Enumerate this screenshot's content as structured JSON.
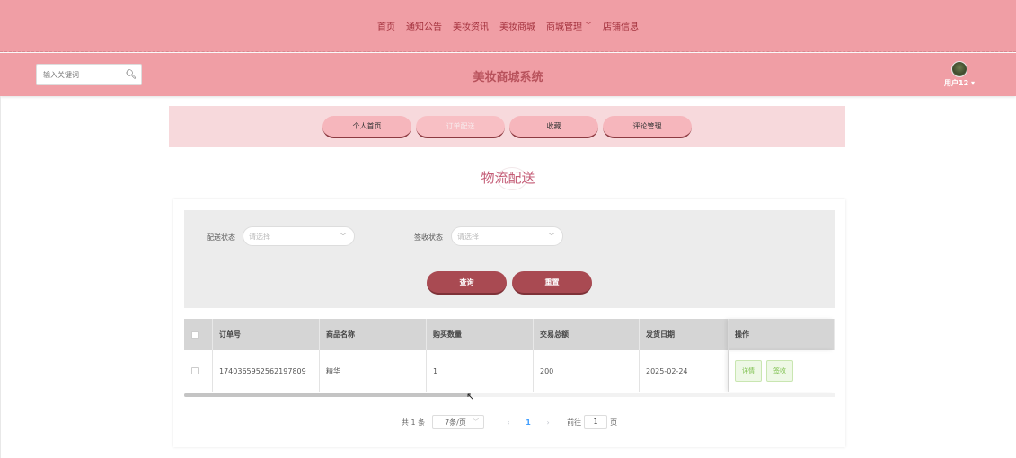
{
  "topnav": {
    "items": [
      "首页",
      "通知公告",
      "美妆资讯",
      "美妆商城",
      "商城管理",
      "店铺信息"
    ]
  },
  "header": {
    "search_placeholder": "输入关键词",
    "site_title": "美妆商城系统",
    "username": "用户12",
    "user_caret": "▾"
  },
  "subnav": {
    "tabs": [
      "个人首页",
      "订单配送",
      "收藏",
      "评论管理"
    ],
    "active_index": 1
  },
  "page": {
    "title": "物流配送"
  },
  "filters": {
    "delivery_status_label": "配送状态",
    "delivery_status_placeholder": "请选择",
    "receipt_status_label": "签收状态",
    "receipt_status_placeholder": "请选择",
    "query_label": "查询",
    "reset_label": "重置"
  },
  "table": {
    "columns": [
      "订单号",
      "商品名称",
      "购买数量",
      "交易总额",
      "发货日期",
      "操作"
    ],
    "rows": [
      {
        "order_no": "1740365952562197809",
        "product": "精华",
        "qty": "1",
        "total": "200",
        "ship_date": "2025-02-24",
        "actions": [
          "详情",
          "签收"
        ]
      }
    ]
  },
  "pagination": {
    "total_text": "共 1 条",
    "page_size": "7条/页",
    "current_page": "1",
    "goto_label": "前往",
    "goto_value": "1",
    "page_suffix": "页"
  },
  "colors": {
    "nav_bg": "#f09ea5",
    "accent_dark": "#a94a52",
    "title_pink": "#c45d77"
  }
}
